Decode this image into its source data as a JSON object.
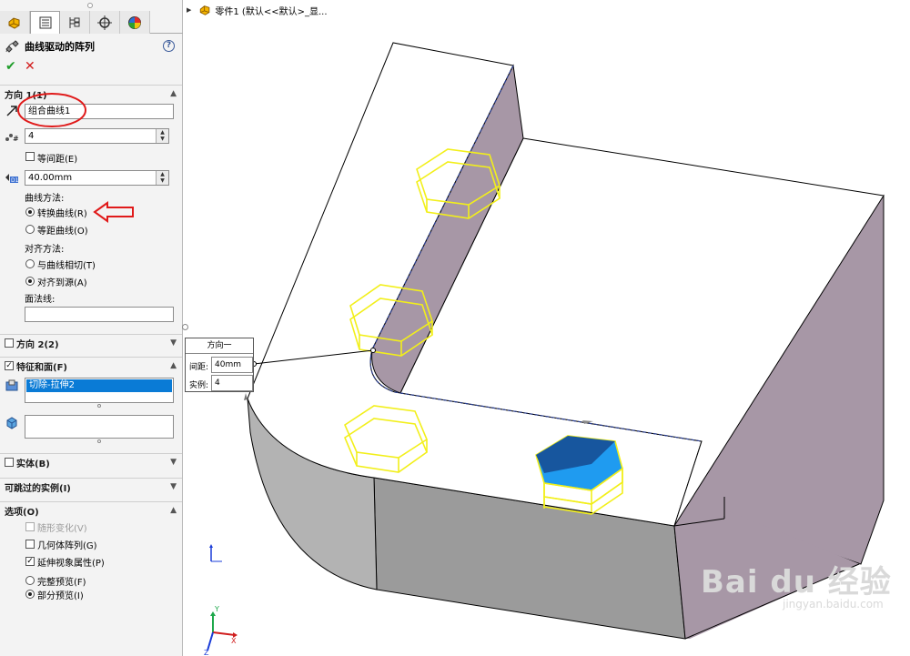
{
  "panel": {
    "tabs": [
      "feature-manager",
      "property-manager",
      "configuration-manager",
      "dimxpert-manager",
      "display-manager"
    ],
    "title": "曲线驱动的阵列",
    "help": "?",
    "ok_symbol": "✔",
    "cancel_symbol": "✕"
  },
  "direction1": {
    "label": "方向 1(1)",
    "curve": "组合曲线1",
    "instances": "4",
    "equal_spacing_label": "等间距(E)",
    "spacing": "40.00mm",
    "curve_method_label": "曲线方法:",
    "transform_curve_label": "转换曲线(R)",
    "offset_curve_label": "等距曲线(O)",
    "align_method_label": "对齐方法:",
    "tangent_label": "与曲线相切(T)",
    "align_source_label": "对齐到源(A)",
    "face_normal_label": "面法线:",
    "face_normal_value": ""
  },
  "direction2": {
    "label": "方向 2(2)"
  },
  "features": {
    "label": "特征和面(F)",
    "selected": "切除-拉伸2"
  },
  "bodies": {
    "label": "实体(B)"
  },
  "skip": {
    "label": "可跳过的实例(I)"
  },
  "options": {
    "label": "选项(O)",
    "vary_sketch": "随形变化(V)",
    "geometry_pattern": "几何体阵列(G)",
    "propagate_visual": "延伸视象属性(P)",
    "full_preview": "完整预览(F)",
    "partial_preview": "部分预览(I)"
  },
  "breadcrumb": {
    "text": "零件1  (默认<<默认>_显..."
  },
  "callout": {
    "title": "方向一",
    "spacing_label": "间距:",
    "spacing_value": "40mm",
    "instances_label": "实例:",
    "instances_value": "4"
  },
  "watermark": {
    "brand": "Bai du 经验",
    "url": "jingyan.baidu.com"
  },
  "colors": {
    "selection": "#0a7bd6",
    "preview_outline": "#f2ef1a",
    "cut_face": "#1f9bf0",
    "side_face": "#a797a6",
    "front_face": "#9b9b9b",
    "annotation_red": "#e01a1a"
  }
}
